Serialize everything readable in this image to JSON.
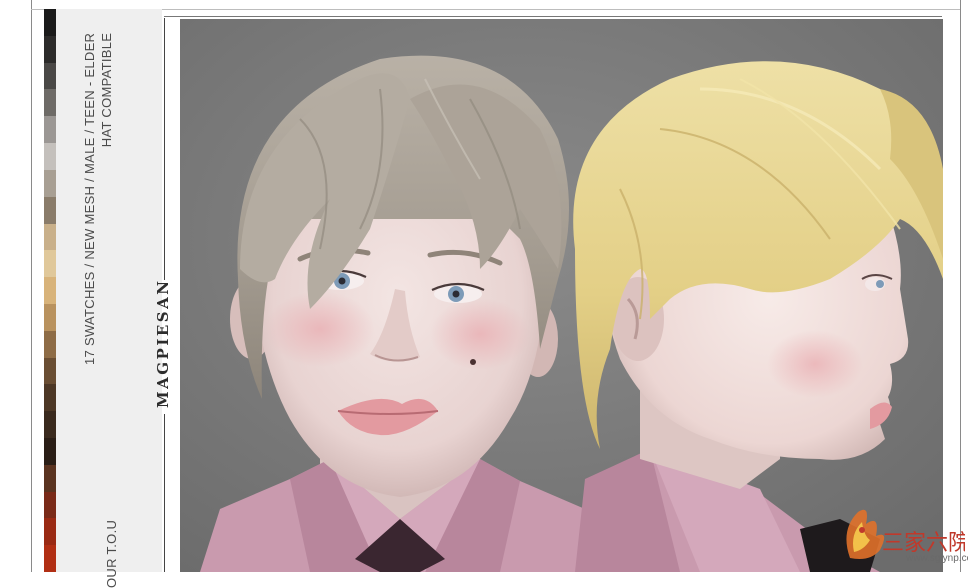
{
  "info": {
    "line1": "17 SWATCHES / NEW MESH / MALE / TEEN - ELDER",
    "line2": "HAT COMPATIBLE",
    "tou": "OUR T.O.U"
  },
  "brand": {
    "name": "MAGPIESAN"
  },
  "swatch_colors": [
    "#1a1a1a",
    "#2c2b2a",
    "#4a4846",
    "#6e6b67",
    "#9b9794",
    "#c4c0bc",
    "#a89f93",
    "#8a7c6a",
    "#c9b08a",
    "#e0c89a",
    "#d8b37a",
    "#b9925e",
    "#8e6c46",
    "#6a4e33",
    "#4d3826",
    "#3a2a1e",
    "#2a1e16",
    "#5a3320",
    "#7a2a18",
    "#9a2a14",
    "#b12f14"
  ],
  "watermark": {
    "brand": "三家六院",
    "site": "www.sglynp.com"
  },
  "colors": {
    "photo_bg": "#7d7d7d",
    "panel_bg": "#efefef",
    "shirt": "#c99aae"
  }
}
